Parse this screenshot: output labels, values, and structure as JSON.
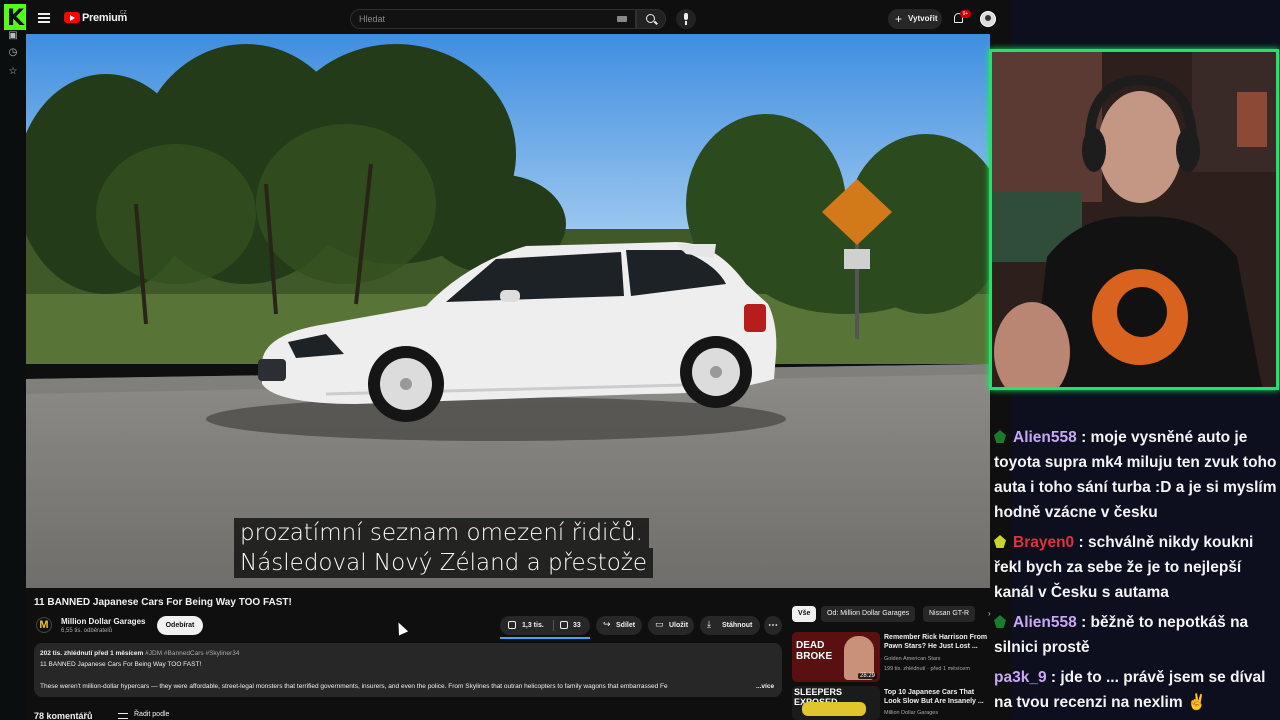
{
  "header": {
    "brand": "Premium",
    "country": "CZ",
    "search_placeholder": "Hledat",
    "create_label": "Vytvořit",
    "notifications_count": "9+"
  },
  "video": {
    "subtitle_line1": "prozatímní seznam omezení řidičů.",
    "subtitle_line2": "Následoval Nový Zéland a přestože"
  },
  "info": {
    "title": "11 BANNED Japanese Cars For Being Way TOO FAST!",
    "channel_initial": "M",
    "channel_name": "Million Dollar Garages",
    "subscribers": "6,55 tis. odběratelů",
    "subscribe_label": "Odebírat",
    "likes": "1,3 tis.",
    "dislikes": "33",
    "share_label": "Sdílet",
    "save_label": "Uložit",
    "download_label": "Stáhnout",
    "more_label": "⋯"
  },
  "description": {
    "stats": "202 tis. zhlédnutí  před 1 měsícem",
    "tags": "#JDM #BannedCars #Skyliner34",
    "line1": "11 BANNED Japanese Cars For Being Way TOO FAST!",
    "line2": "These weren't million-dollar hypercars — they were affordable, street-legal monsters that terrified governments, insurers, and even the police. From Skylines that outran helicopters to family wagons that embarrassed Fe",
    "more": "...více"
  },
  "comments": {
    "count_label": "78 komentářů",
    "sort_label": "Řadit podle"
  },
  "related": {
    "chips": [
      "Vše",
      "Od: Million Dollar Garages",
      "Nissan GT-R"
    ],
    "items": [
      {
        "thumb_text": "DEAD BROKE",
        "duration": "28:29",
        "title": "Remember Rick Harrison From Pawn Stars? He Just Lost ...",
        "channel": "Golden American Stars",
        "meta": "199 tis. zhlédnutí · před 1 měsícem"
      },
      {
        "thumb_text": "SLEEPERS EXPOSED",
        "duration": "",
        "title": "Top 10 Japanese Cars That Look Slow But Are Insanely ...",
        "channel": "Million Dollar Garages",
        "meta": ""
      }
    ]
  },
  "chat": [
    {
      "user": "Alien558",
      "color": "#c9a7f5",
      "message": "moje vysněné auto je toyota supra mk4 miluju ten zvuk toho auta i toho sání turba :D a je si myslím hodně vzácne v česku"
    },
    {
      "user": "Brayen0",
      "color": "#e0313f",
      "message": "schválně nikdy koukni řekl bych za sebe že je to nejlepší kanál v Česku s autama"
    },
    {
      "user": "Alien558",
      "color": "#c9a7f5",
      "message": "běžně to nepotkáš na silnici prostě"
    },
    {
      "user": "pa3k_9",
      "color": "#c9a7f5",
      "message": "jde to ... právě jsem se díval na tvou recenzi na nexlim ✌️"
    }
  ],
  "colors": {
    "kick_green": "#53fc18",
    "cam_border": "#22e26a",
    "yt_red": "#ff0000",
    "like_accent": "#3ea6ff"
  }
}
